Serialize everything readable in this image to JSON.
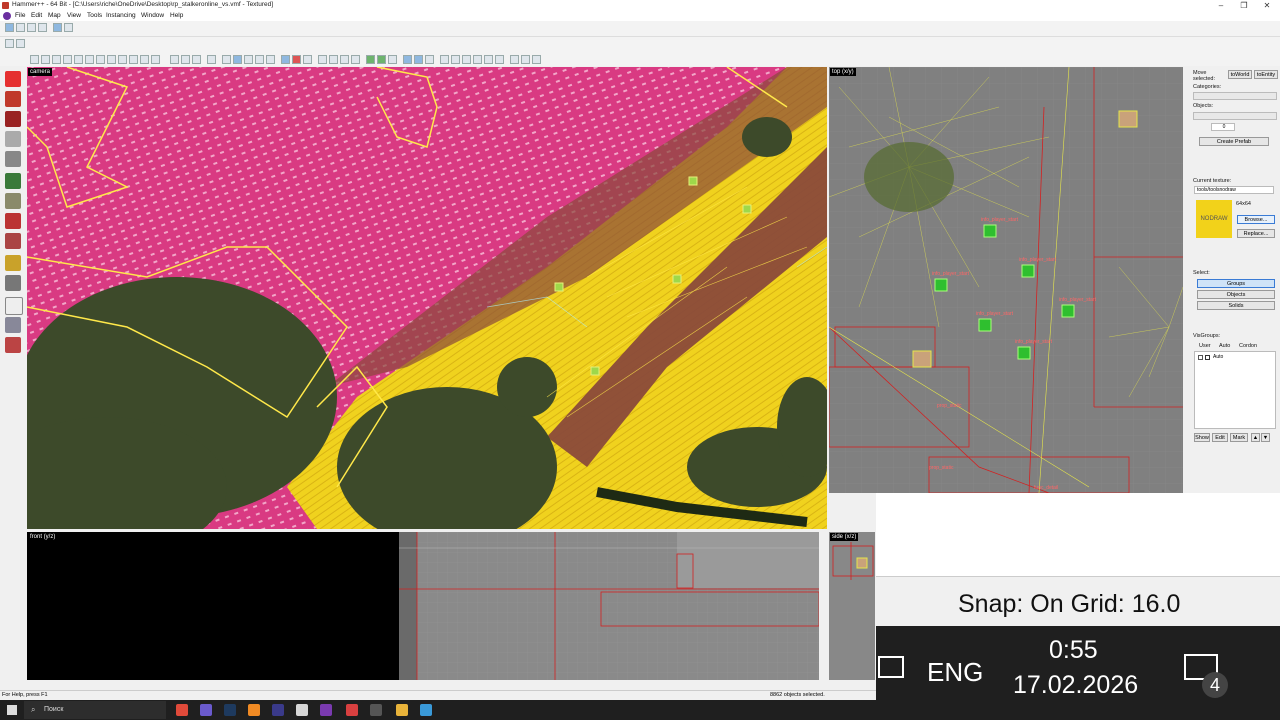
{
  "window": {
    "title": "Hammer++ - 64 Bit - [C:\\Users\\riche\\OneDrive\\Desktop\\rp_stalkeronline_vs.vmf - Textured]",
    "minimize_glyph": "–",
    "maximize_glyph": "❐",
    "close_glyph": "✕"
  },
  "menu": [
    "File",
    "Edit",
    "Map",
    "View",
    "Tools",
    "Instancing",
    "Window",
    "Help"
  ],
  "viewports": {
    "camera": "camera",
    "top": "top (x/y)",
    "front": "front (y/z)",
    "side": "side (x/z)"
  },
  "entity_labels": [
    "info_player_start",
    "info_player_start",
    "info_player_start",
    "info_player_start",
    "info_player_start",
    "info_player_start",
    "prop_static",
    "prop_static",
    "func_detail"
  ],
  "right_panel": {
    "move_selected": "Move selected:",
    "to_world": "toWorld",
    "to_entity": "toEntity",
    "categories": "Categories:",
    "objects": "Objects:",
    "spin_value": "0",
    "create_prefab": "Create Prefab",
    "current_texture": "Current texture:",
    "texture_name": "tools/toolsnodraw",
    "texture_size": "64x64",
    "texture_preview": "NODRAW",
    "browse": "Browse...",
    "replace": "Replace...",
    "select": "Select:",
    "groups": "Groups",
    "objects_btn": "Objects",
    "solids": "Solids",
    "visgroups": "VisGroups:",
    "tab_user": "User",
    "tab_auto": "Auto",
    "tab_cordon": "Cordon",
    "tree_auto": "Auto",
    "show": "Show",
    "edit": "Edit",
    "mark": "Mark"
  },
  "status": {
    "help": "For Help, press F1",
    "objects_selected": "8862 objects selected."
  },
  "taskbar": {
    "search_placeholder": "Поиск"
  },
  "overlay": {
    "snap": "Snap: On Grid: 16.0",
    "lang": "ENG",
    "time": "0:55",
    "date": "17.02.2026",
    "notifications": "4"
  },
  "colors": {
    "camera_pink": "#d93a82",
    "ground_yellow": "#f0d21e",
    "road_brown": "#8a4a3a",
    "foliage": "#3d4a2a",
    "wire_yellow": "#e6e64a",
    "wire_red": "#d32020",
    "texture_yellow": "#f2d21a",
    "select_blue": "#cfe3f7"
  }
}
